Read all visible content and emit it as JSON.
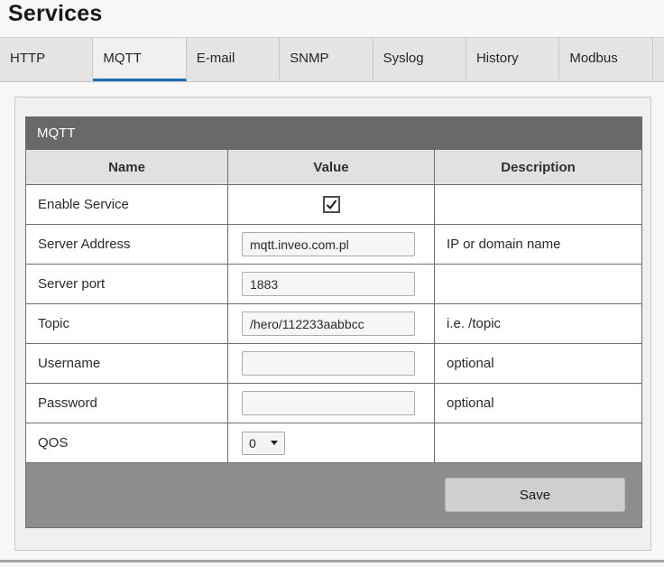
{
  "page": {
    "title": "Services"
  },
  "tabs": [
    {
      "label": "HTTP",
      "active": false
    },
    {
      "label": "MQTT",
      "active": true
    },
    {
      "label": "E-mail",
      "active": false
    },
    {
      "label": "SNMP",
      "active": false
    },
    {
      "label": "Syslog",
      "active": false
    },
    {
      "label": "History",
      "active": false
    },
    {
      "label": "Modbus",
      "active": false
    }
  ],
  "colors": {
    "tab_underline": "#1d6fb5",
    "section_bar": "#696969",
    "footer_bar": "#8d8d8d",
    "header_row": "#e1e1e1"
  },
  "panel": {
    "section_title": "MQTT",
    "columns": [
      "Name",
      "Value",
      "Description"
    ],
    "rows": [
      {
        "name": "Enable Service",
        "type": "checkbox",
        "checked": true,
        "description": ""
      },
      {
        "name": "Server Address",
        "type": "text",
        "value": "mqtt.inveo.com.pl",
        "description": "IP or domain name"
      },
      {
        "name": "Server port",
        "type": "text",
        "value": "1883",
        "description": ""
      },
      {
        "name": "Topic",
        "type": "text",
        "value": "/hero/112233aabbcc",
        "description": "i.e. /topic"
      },
      {
        "name": "Username",
        "type": "text",
        "value": "",
        "description": "optional"
      },
      {
        "name": "Password",
        "type": "text",
        "value": "",
        "description": "optional"
      },
      {
        "name": "QOS",
        "type": "select",
        "value": "0",
        "description": ""
      }
    ],
    "save_label": "Save"
  }
}
